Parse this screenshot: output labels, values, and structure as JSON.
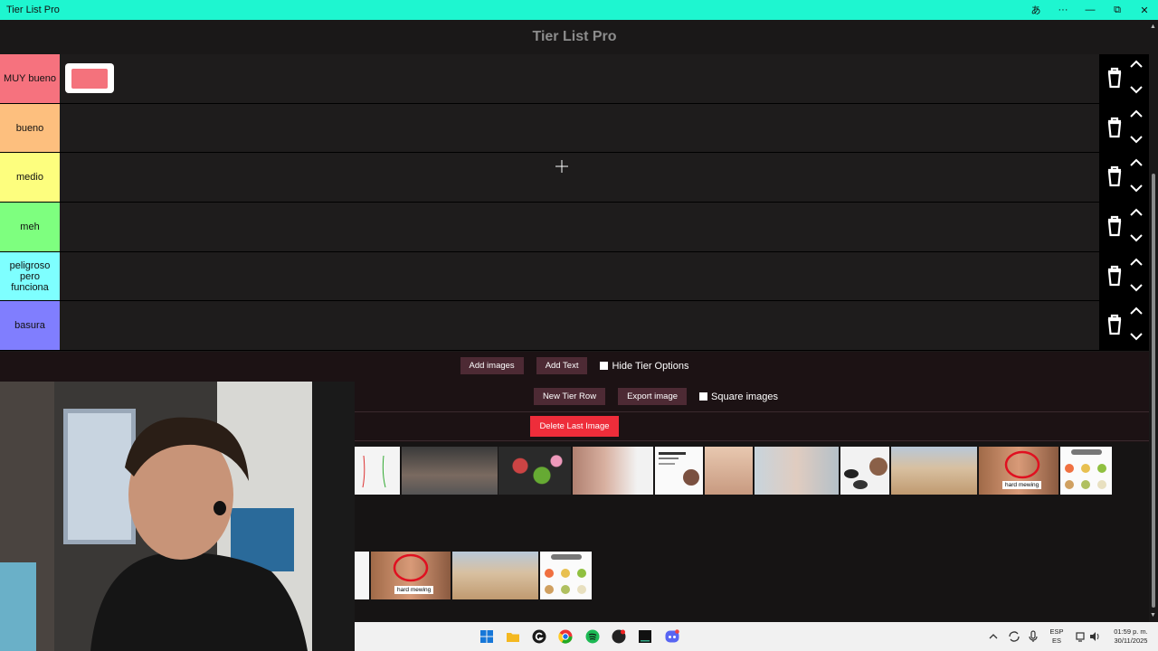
{
  "window": {
    "title": "Tier List Pro",
    "controls": [
      "あ",
      "···",
      "—",
      "⧉",
      "✕"
    ]
  },
  "app": {
    "title": "Tier List Pro",
    "tiers": [
      {
        "label": "MUY bueno",
        "color": "#f6727e"
      },
      {
        "label": "bueno",
        "color": "#fdbf7e"
      },
      {
        "label": "medio",
        "color": "#fdfe7e"
      },
      {
        "label": "meh",
        "color": "#7eff7f"
      },
      {
        "label": "peligroso pero funciona",
        "color": "#7effff"
      },
      {
        "label": "basura",
        "color": "#807efe"
      }
    ],
    "buttons": {
      "add_images": "Add images",
      "add_text": "Add Text",
      "hide_tier_options": "Hide Tier Options",
      "new_tier_row": "New Tier Row",
      "export_image": "Export image",
      "square_images": "Square images",
      "delete_last_image": "Delete Last Image"
    },
    "pool_images_row1": [
      "hard mewing"
    ],
    "pool_images_row2": [
      "hard mewing"
    ]
  },
  "taskbar": {
    "language": "ESP",
    "language_sub": "ES",
    "time": "01:59 p. m.",
    "date": "30/11/2025"
  },
  "colors": {
    "titlebar": "#1ef6d0",
    "button": "#4d2a34",
    "danger": "#ee2d3a"
  }
}
